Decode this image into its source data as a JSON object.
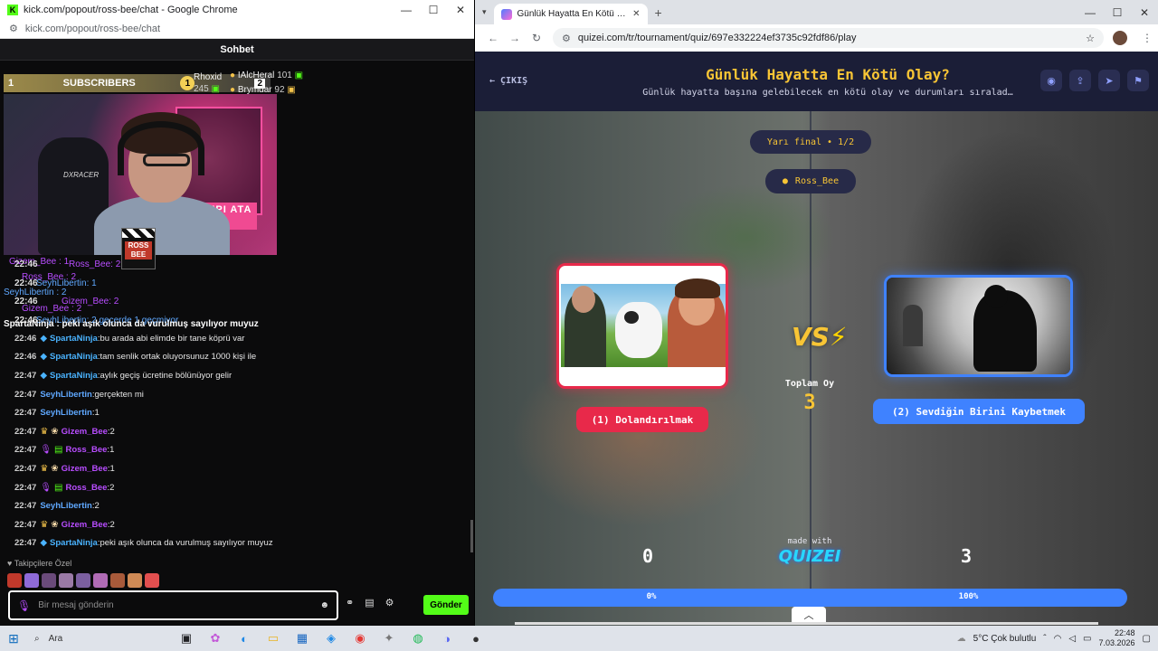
{
  "left_window": {
    "title": "kick.com/popout/ross-bee/chat - Google Chrome",
    "url": "kick.com/popout/ross-bee/chat",
    "chat_header": "Sohbet",
    "sub_goal": {
      "left_number": "1",
      "label": "SUBSCRIBERS",
      "badge": "1",
      "right_number": "2"
    },
    "gifters": [
      {
        "name": "Rhoxid",
        "count": "245"
      },
      {
        "name": "IAlcHeral",
        "count": "101"
      },
      {
        "name": "Brymdar",
        "count": "92"
      }
    ],
    "streamer_tag": "ROSS BEE",
    "chair_logo": "DXRACER",
    "wall_sign": "PIPI ATA",
    "overlapping_messages": [
      "Gizem_Bee : 1",
      "22:46",
      "Ross_Bee: 2",
      "Ross_Bee : 2",
      "SeyhLibertin : 2",
      "22:46",
      "SeyhLibertin: 1",
      "22:46",
      "Gizem_Bee: 2",
      "Gizem_Bee : 2",
      "22:46",
      "SeyhLibertin: 2 geçerde 1 geçmiyor",
      "SpartaNinja : peki aşık olunca da vurulmuş sayılıyor muyuz"
    ],
    "messages": [
      {
        "time": "22:46",
        "badges": [
          "shield"
        ],
        "user": "SpartaNinja",
        "color": "#4ab3ff",
        "text": "bu arada abi elimde bir tane köprü var"
      },
      {
        "time": "22:46",
        "badges": [
          "shield"
        ],
        "user": "SpartaNinja",
        "color": "#4ab3ff",
        "text": "tam senlik ortak oluyorsunuz 1000 kişi ile"
      },
      {
        "time": "22:47",
        "badges": [
          "shield"
        ],
        "user": "SpartaNinja",
        "color": "#4ab3ff",
        "text": "aylık geçiş ücretine bölünüyor gelir"
      },
      {
        "time": "22:47",
        "badges": [],
        "user": "SeyhLibertin",
        "color": "#5fa8ff",
        "text": "gerçekten mi"
      },
      {
        "time": "22:47",
        "badges": [],
        "user": "SeyhLibertin",
        "color": "#5fa8ff",
        "text": "1"
      },
      {
        "time": "22:47",
        "badges": [
          "crown",
          "gift"
        ],
        "user": "Gizem_Bee",
        "color": "#b84dff",
        "text": "2"
      },
      {
        "time": "22:47",
        "badges": [
          "mic",
          "gift2"
        ],
        "user": "Ross_Bee",
        "color": "#b84dff",
        "text": "1"
      },
      {
        "time": "22:47",
        "badges": [
          "crown",
          "gift"
        ],
        "user": "Gizem_Bee",
        "color": "#b84dff",
        "text": "1"
      },
      {
        "time": "22:47",
        "badges": [
          "mic",
          "gift2"
        ],
        "user": "Ross_Bee",
        "color": "#b84dff",
        "text": "2"
      },
      {
        "time": "22:47",
        "badges": [],
        "user": "SeyhLibertin",
        "color": "#5fa8ff",
        "text": "2"
      },
      {
        "time": "22:47",
        "badges": [
          "crown",
          "gift"
        ],
        "user": "Gizem_Bee",
        "color": "#b84dff",
        "text": "2"
      },
      {
        "time": "22:47",
        "badges": [
          "shield"
        ],
        "user": "SpartaNinja",
        "color": "#4ab3ff",
        "text": "peki aşık olunca da vurulmuş sayılıyor muyuz"
      }
    ],
    "followers_only_label": "Takipçilere Özel",
    "input_placeholder": "Bir mesaj gönderin",
    "send_label": "Gönder"
  },
  "right_window": {
    "tab_title": "Günlük Hayatta En Kötü Olay?",
    "url": "quizei.com/tr/tournament/quiz/697e332224ef3735c92fdf86/play",
    "exit_label": "← ÇIKIŞ",
    "title": "Günlük Hayatta En Kötü Olay?",
    "subtitle": "Günlük hayatta başına gelebilecek en kötü olay ve durumları sıralad…",
    "round_label": "Yarı final • 1/2",
    "player_name": "Ross_Bee",
    "vs_label": "VS",
    "total_votes_label": "Toplam Oy",
    "total_votes": "3",
    "option_a": {
      "label": "(1) Dolandırılmak",
      "score": "0",
      "percent": "0%",
      "share": 0
    },
    "option_b": {
      "label": "(2) Sevdiğin Birini Kaybetmek",
      "score": "3",
      "percent": "100%",
      "share": 1
    },
    "made_with": "made with",
    "brand": "QUIZEI",
    "colors": {
      "accent_yellow": "#f8c535",
      "option_a": "#e8294a",
      "option_b": "#3f82ff",
      "header_bg": "#1b1e37"
    }
  },
  "taskbar": {
    "search_label": "Ara",
    "weather": "5°C  Çok bulutlu",
    "time": "22:48",
    "date": "7.03.2026"
  }
}
